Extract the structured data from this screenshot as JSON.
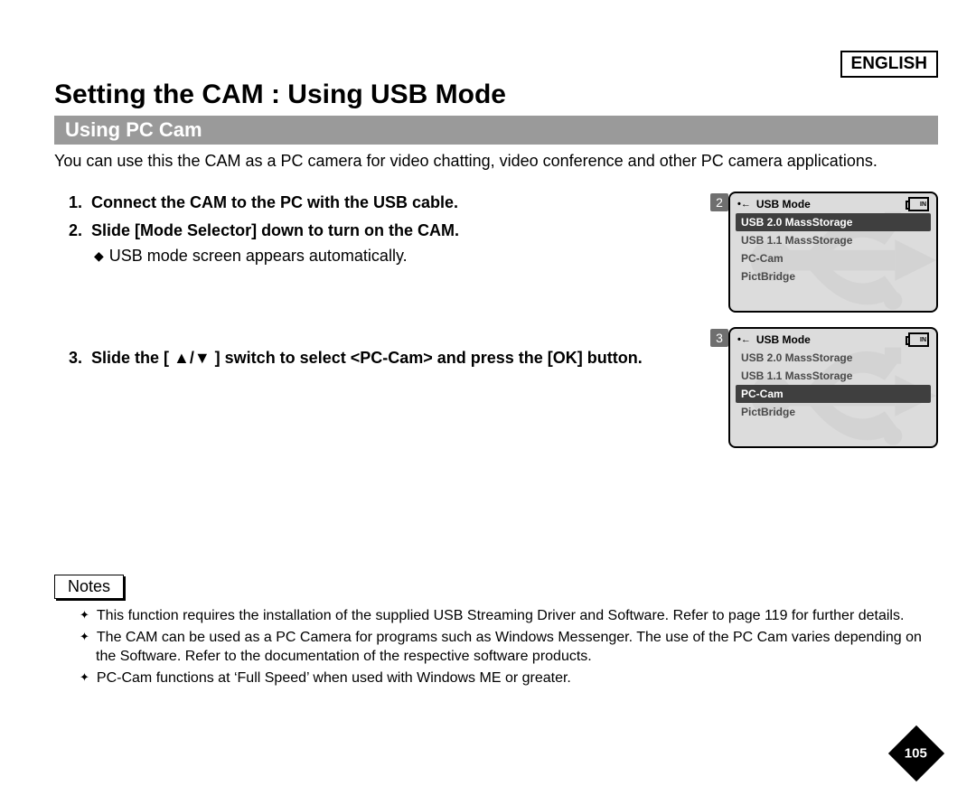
{
  "header": {
    "language": "ENGLISH",
    "title": "Setting the CAM : Using USB Mode",
    "section": "Using PC Cam"
  },
  "intro": "You can use this the CAM as a PC camera for video chatting, video conference and other PC camera applications.",
  "steps": {
    "s1_num": "1.",
    "s1_text": "Connect the CAM to the PC with the USB cable.",
    "s2_num": "2.",
    "s2_text": "Slide [Mode Selector] down to turn on the CAM.",
    "s2_sub": "USB mode screen appears automatically.",
    "s3_num": "3.",
    "s3_text": "Slide the [ ▲/▼ ] switch to select <PC-Cam> and press the [OK] button."
  },
  "lcd": {
    "title": "USB Mode",
    "in_label": "IN",
    "items": {
      "i0": "USB 2.0 MassStorage",
      "i1": "USB 1.1 MassStorage",
      "i2": "PC-Cam",
      "i3": "PictBridge"
    },
    "panel2_num": "2",
    "panel3_num": "3"
  },
  "notes": {
    "label": "Notes",
    "n1": "This function requires the installation of the supplied USB Streaming Driver and Software. Refer to page 119 for further details.",
    "n2": "The CAM can be used as a PC Camera for programs such as Windows Messenger. The use of the PC Cam varies depending on the Software. Refer to the documentation of the respective software products.",
    "n3": "PC-Cam functions at ‘Full Speed’ when used with Windows ME or greater."
  },
  "page_number": "105"
}
